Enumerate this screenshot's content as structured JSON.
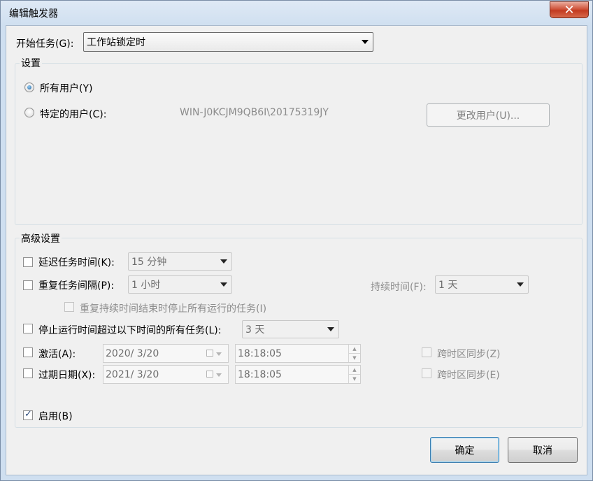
{
  "window": {
    "title": "编辑触发器",
    "close_glyph": "✕"
  },
  "start_task": {
    "label": "开始任务(G):",
    "value": "工作站锁定时"
  },
  "settings": {
    "title": "设置",
    "all_users": "所有用户(Y)",
    "specific_user": "特定的用户(C):",
    "user_name": "WIN-J0KCJM9QB6I\\20175319JY",
    "change_user_button": "更改用户(U)..."
  },
  "advanced": {
    "title": "高级设置",
    "delay": {
      "label": "延迟任务时间(K):",
      "value": "15 分钟",
      "checked": false
    },
    "repeat": {
      "label": "重复任务间隔(P):",
      "value": "1 小时",
      "checked": false
    },
    "duration": {
      "label": "持续时间(F):",
      "value": "1 天"
    },
    "stop_at_end": {
      "label": "重复持续时间结束时停止所有运行的任务(I)"
    },
    "stop_longer": {
      "label": "停止运行时间超过以下时间的所有任务(L):",
      "value": "3 天",
      "checked": false
    },
    "activate": {
      "label": "激活(A):",
      "date": "2020/  3/20",
      "time": "18:18:05",
      "sync": "跨时区同步(Z)"
    },
    "expire": {
      "label": "过期日期(X):",
      "date": "2021/  3/20",
      "time": "18:18:05",
      "sync": "跨时区同步(E)"
    },
    "enabled": {
      "label": "启用(B)",
      "checked": true
    }
  },
  "buttons": {
    "ok": "确定",
    "cancel": "取消"
  },
  "colors": {
    "accent_border": "#3c7fb1",
    "close_red": "#c23a1f",
    "disabled_text": "#8c8c8c"
  }
}
